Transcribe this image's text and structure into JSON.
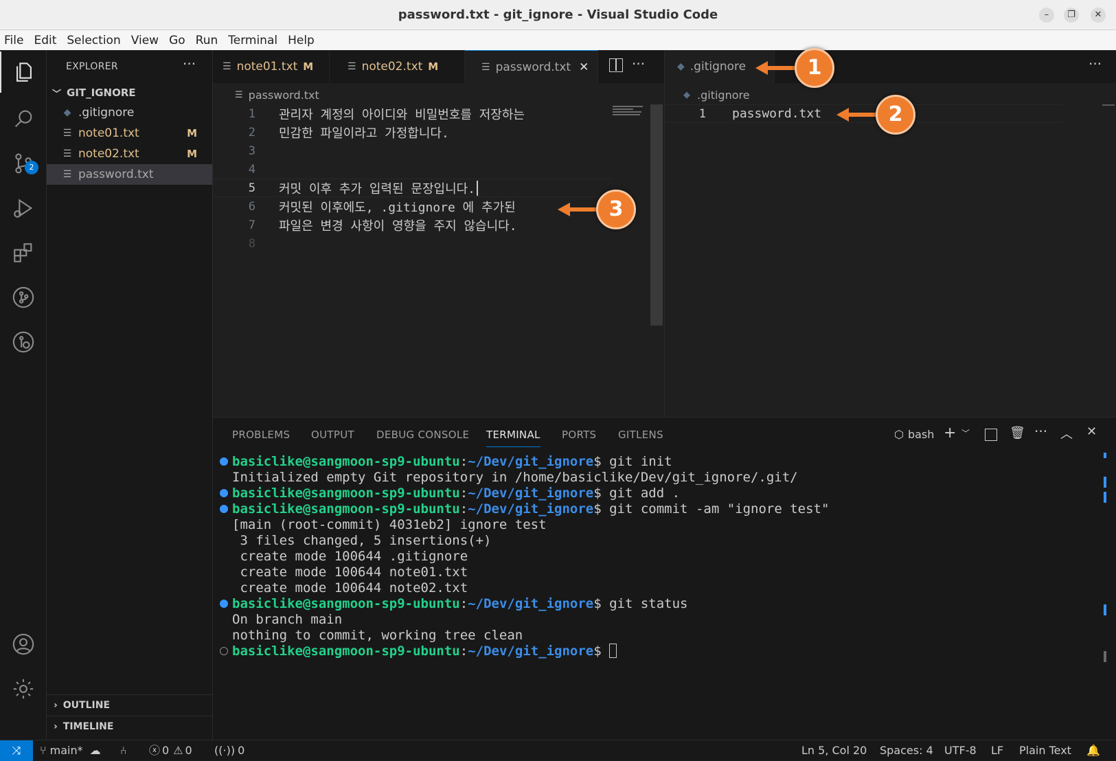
{
  "window": {
    "title": "password.txt - git_ignore - Visual Studio Code",
    "min": "–",
    "max": "❐",
    "close": "✕"
  },
  "menu": [
    "File",
    "Edit",
    "Selection",
    "View",
    "Go",
    "Run",
    "Terminal",
    "Help"
  ],
  "activity": {
    "scm_badge": "2"
  },
  "explorer": {
    "title": "EXPLORER",
    "more": "···",
    "folder": "GIT_IGNORE",
    "files": [
      {
        "name": ".gitignore",
        "status": ""
      },
      {
        "name": "note01.txt",
        "status": "M"
      },
      {
        "name": "note02.txt",
        "status": "M"
      },
      {
        "name": "password.txt",
        "status": ""
      }
    ],
    "outline": "OUTLINE",
    "timeline": "TIMELINE"
  },
  "editor_left": {
    "tabs": [
      {
        "label": "note01.txt",
        "badge": "M"
      },
      {
        "label": "note02.txt",
        "badge": "M"
      },
      {
        "label": "password.txt",
        "badge": ""
      }
    ],
    "close": "✕",
    "more": "···",
    "breadcrumb": "password.txt",
    "lines": [
      {
        "n": "1",
        "text": "관리자 계정의 아이디와 비밀번호를 저장하는"
      },
      {
        "n": "2",
        "text": "민감한 파일이라고 가정합니다."
      },
      {
        "n": "3",
        "text": ""
      },
      {
        "n": "4",
        "text": ""
      },
      {
        "n": "5",
        "text": "커밋 이후 추가 입력된 문장입니다."
      },
      {
        "n": "6",
        "text": "커밋된 이후에도, .gitignore 에 추가된"
      },
      {
        "n": "7",
        "text": "파일은 변경 사항이 영향을 주지 않습니다."
      },
      {
        "n": "8",
        "text": ""
      }
    ]
  },
  "editor_right": {
    "tab": ".gitignore",
    "more": "···",
    "breadcrumb": ".gitignore",
    "lines": [
      {
        "n": "1",
        "text": "password.txt"
      }
    ]
  },
  "panel": {
    "tabs": [
      "PROBLEMS",
      "OUTPUT",
      "DEBUG CONSOLE",
      "TERMINAL",
      "PORTS",
      "GITLENS"
    ],
    "active_tab": "TERMINAL",
    "shell": "bash",
    "terminal": {
      "user": "basiclike@sangmoon-sp9-ubuntu",
      "path": "~/Dev/git_ignore",
      "cmd_init": "git init",
      "out_init": "Initialized empty Git repository in /home/basiclike/Dev/git_ignore/.git/",
      "cmd_add": "git add .",
      "cmd_commit": "git commit -am \"ignore test\"",
      "out_commit": [
        "[main (root-commit) 4031eb2] ignore test",
        " 3 files changed, 5 insertions(+)",
        " create mode 100644 .gitignore",
        " create mode 100644 note01.txt",
        " create mode 100644 note02.txt"
      ],
      "cmd_status": "git status",
      "out_status": [
        "On branch main",
        "nothing to commit, working tree clean"
      ]
    }
  },
  "status": {
    "remote": "⤨",
    "branch": "main*",
    "errors": "0",
    "warnings": "0",
    "ports": "0",
    "position": "Ln 5, Col 20",
    "spaces": "Spaces: 4",
    "encoding": "UTF-8",
    "eol": "LF",
    "language": "Plain Text"
  },
  "callouts": [
    "1",
    "2",
    "3"
  ],
  "colors": {
    "accent": "#0078d4",
    "modified": "#e2c08d",
    "callout": "#ef7d2e",
    "term_user": "#23d18b",
    "term_path": "#3b8eea"
  }
}
